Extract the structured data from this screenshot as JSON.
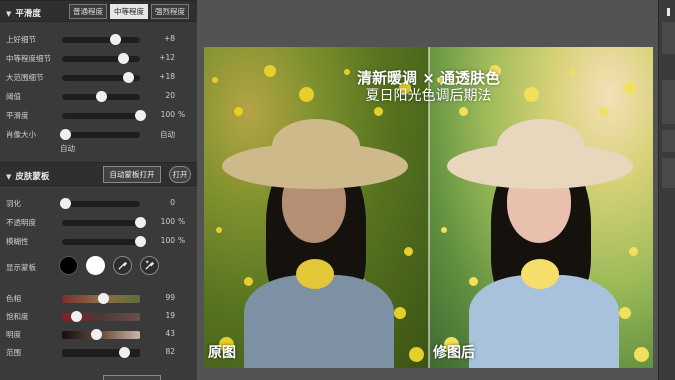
{
  "smooth_section": {
    "title": "平滑度",
    "modes": [
      {
        "label": "普通程度",
        "active": false
      },
      {
        "label": "中等程度",
        "active": true
      },
      {
        "label": "强烈程度",
        "active": false
      }
    ],
    "sliders": [
      {
        "label": "上好细节",
        "value": "+8",
        "unit": "",
        "fraction": 0.68
      },
      {
        "label": "中等程度细节",
        "value": "+12",
        "unit": "",
        "fraction": 0.78
      },
      {
        "label": "大范围细节",
        "value": "+18",
        "unit": "",
        "fraction": 0.84
      },
      {
        "label": "阈值",
        "value": "20",
        "unit": "",
        "fraction": 0.5
      },
      {
        "label": "平滑度",
        "value": "100",
        "unit": "%",
        "fraction": 1.0
      },
      {
        "label": "肖像大小",
        "value": "自动",
        "unit": "",
        "fraction": 0.04
      }
    ],
    "size_sub_label": "自动"
  },
  "skin_mask_section": {
    "title": "皮肤蒙板",
    "auto_mask_button": "自动蒙板打开",
    "open_button": "打开",
    "sliders": [
      {
        "label": "羽化",
        "value": "0",
        "unit": "",
        "fraction": 0.04
      },
      {
        "label": "不透明度",
        "value": "100",
        "unit": "%",
        "fraction": 1.0
      },
      {
        "label": "模糊性",
        "value": "100",
        "unit": "%",
        "fraction": 1.0
      }
    ],
    "show_mask_label": "显示蒙板",
    "swatch_colors": [
      "#000000",
      "#ffffff"
    ],
    "picker_icons": [
      "eyedropper-icon",
      "eyedropper-plus-icon"
    ],
    "color_sliders": [
      {
        "label": "色相",
        "value": "99",
        "fraction": 0.52,
        "gradient": [
          "#7a2f2f",
          "#8f6f45",
          "#5f6d3a"
        ]
      },
      {
        "label": "饱和度",
        "value": "19",
        "fraction": 0.18,
        "gradient": [
          "#8a2020",
          "#4a3838",
          "#6a4e4e"
        ]
      },
      {
        "label": "明度",
        "value": "43",
        "fraction": 0.44,
        "gradient": [
          "#111111",
          "#6a4a3a",
          "#cdb4a6"
        ]
      },
      {
        "label": "范围",
        "value": "82",
        "fraction": 0.8,
        "gradient": [
          "#1e1e1e",
          "#1e1e1e",
          "#1e1e1e"
        ]
      }
    ]
  },
  "photo": {
    "headline_line1": "清新暖调 × 通透肤色",
    "headline_line2": "夏日阳光色调后期法",
    "before_label": "原图",
    "after_label": "修图后"
  }
}
